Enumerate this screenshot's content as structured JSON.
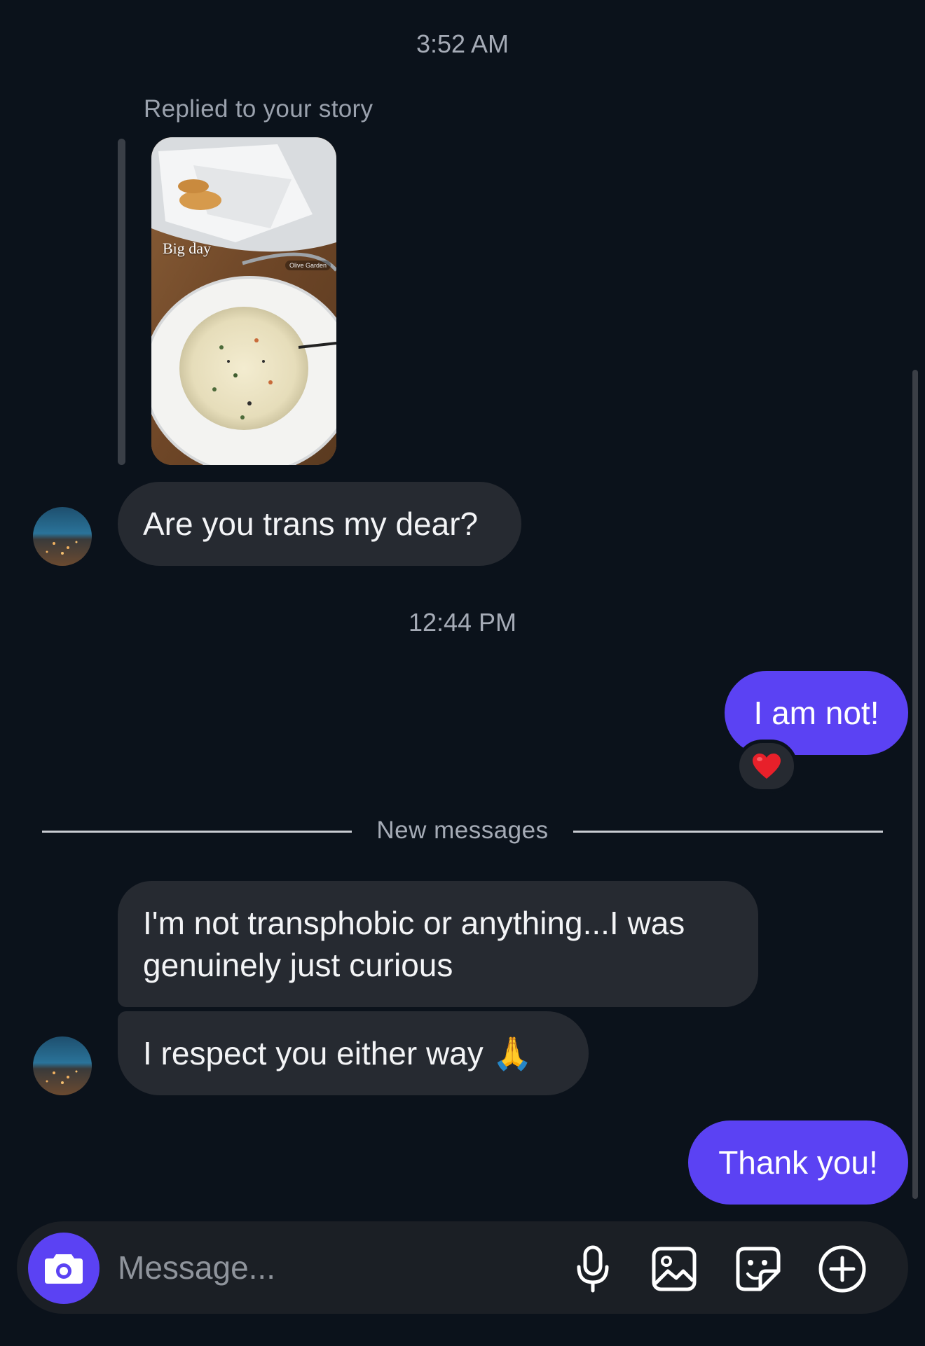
{
  "timestamps": {
    "first": "3:52 AM",
    "second": "12:44 PM"
  },
  "story_reply": {
    "label": "Replied to your story",
    "caption": "Big day",
    "location_tag": "Olive Garden"
  },
  "messages": {
    "incoming_1": "Are you trans my dear?",
    "outgoing_1": "I am not!",
    "reaction": "❤️",
    "incoming_2": "I'm not transphobic or anything...I was genuinely just curious",
    "incoming_3": "I respect you either way 🙏",
    "outgoing_2": "Thank you!"
  },
  "divider": {
    "label": "New messages"
  },
  "composer": {
    "placeholder": "Message..."
  },
  "icons": {
    "camera": "camera-icon",
    "mic": "microphone-icon",
    "gallery": "gallery-icon",
    "sticker": "sticker-icon",
    "add": "plus-circle-icon"
  },
  "colors": {
    "background": "#0b121b",
    "incoming_bubble": "#262a31",
    "outgoing_bubble": "#5b42f3",
    "accent": "#5b42f3"
  }
}
